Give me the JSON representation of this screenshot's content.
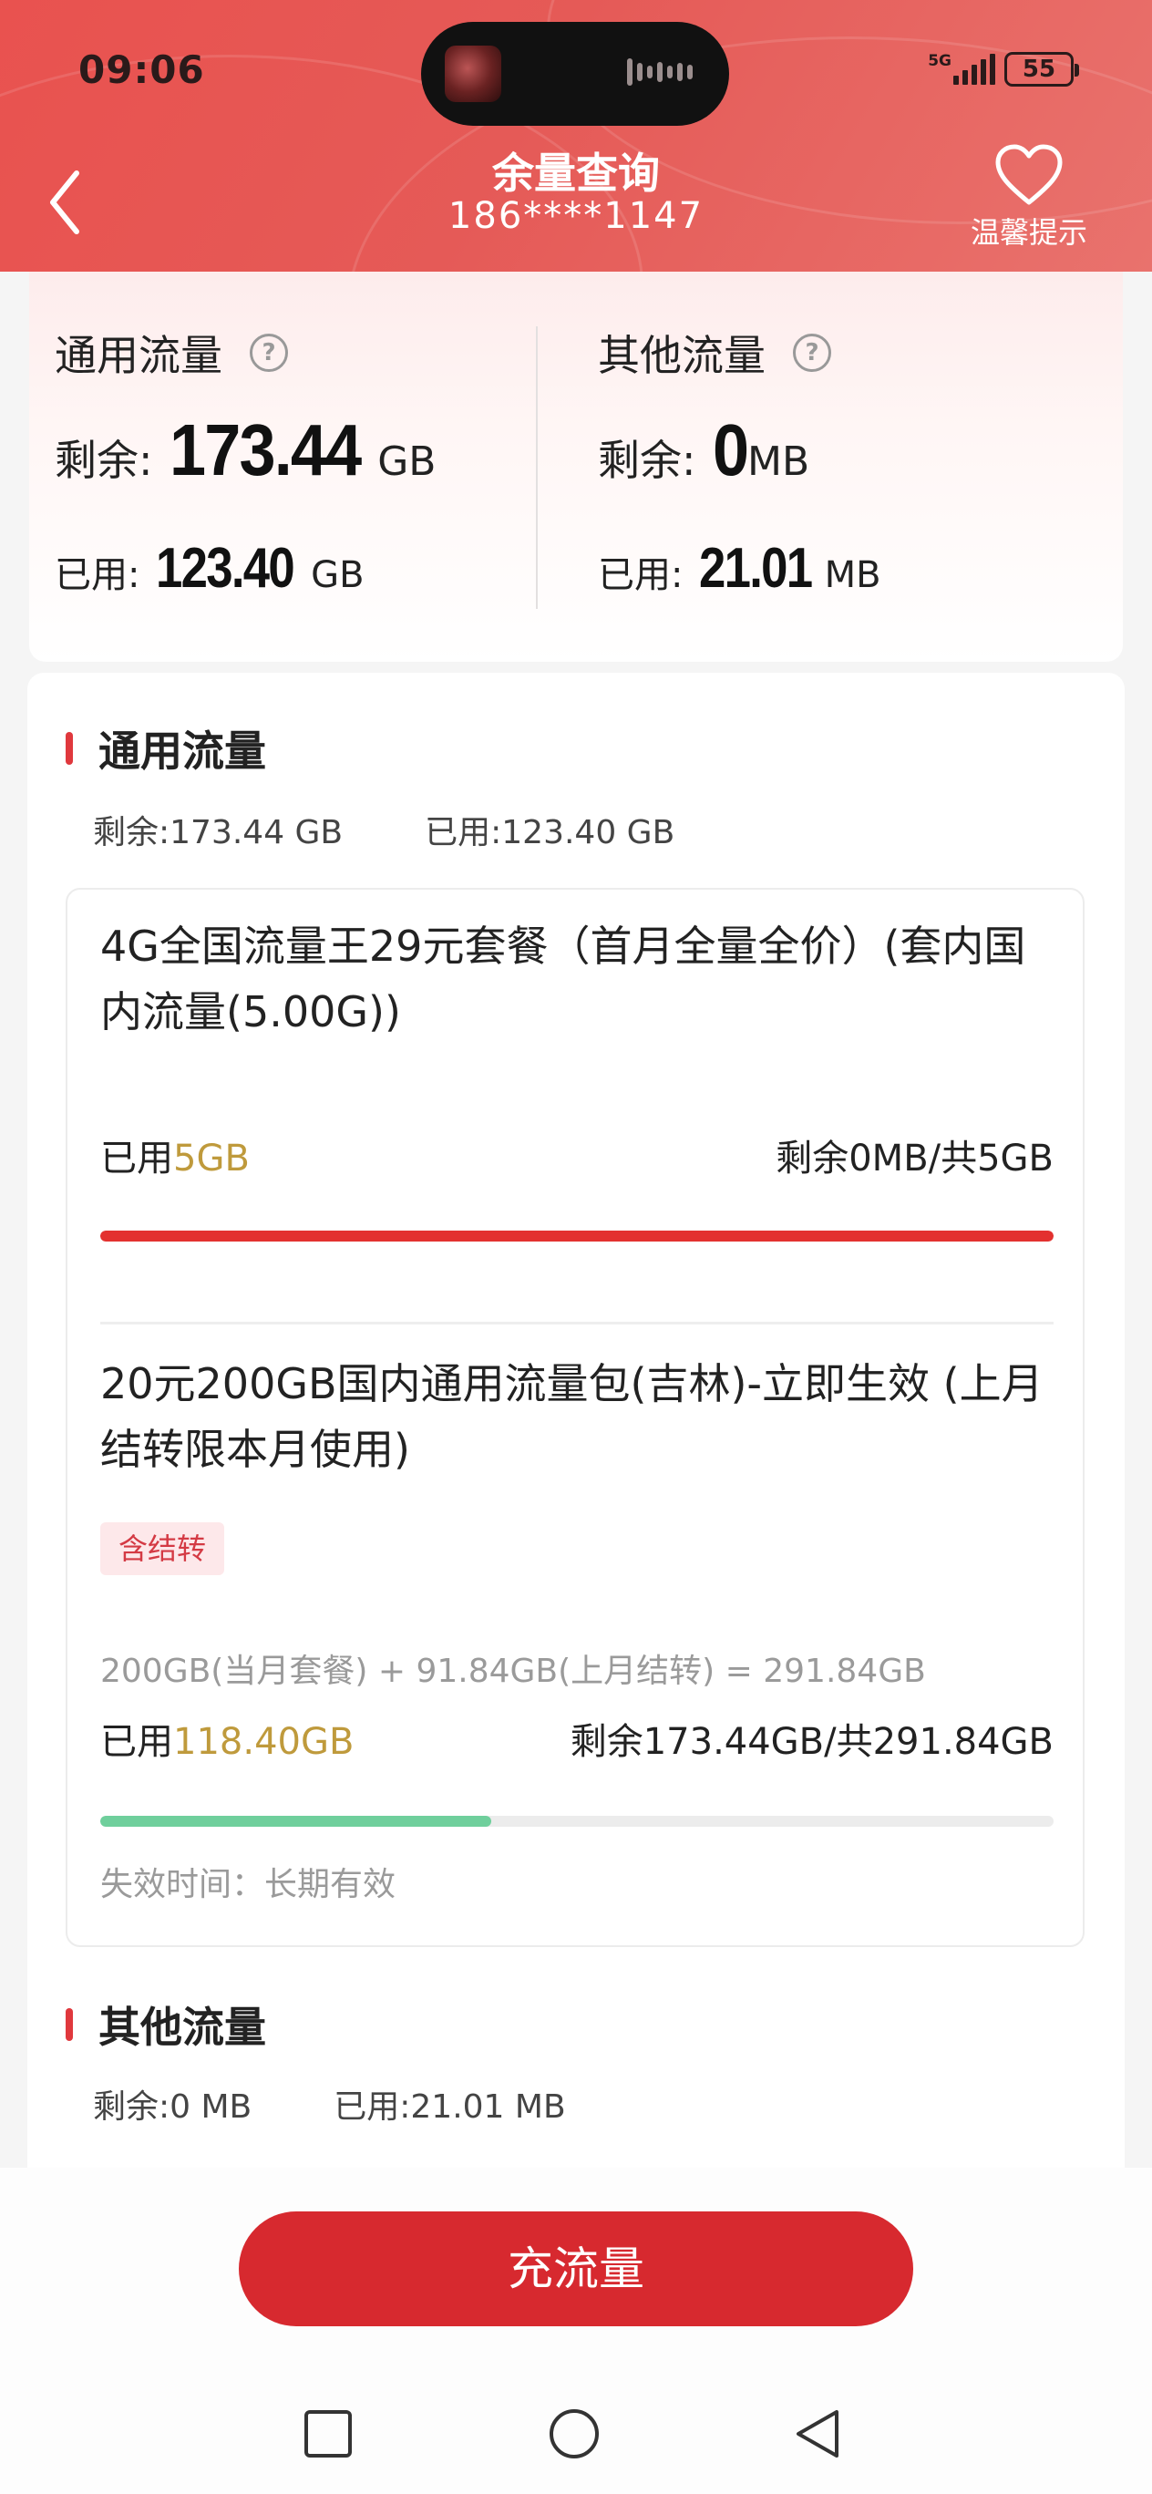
{
  "status_bar": {
    "time": "09:06",
    "network": "5G",
    "battery": "55"
  },
  "header": {
    "title": "余量查询",
    "phone": "186****1147",
    "tip_label": "温馨提示",
    "colors": {
      "brand_red": "#e55a57"
    }
  },
  "summary": {
    "general": {
      "title": "通用流量",
      "remain_label": "剩余:",
      "remain_value": "173.44",
      "remain_unit": "GB",
      "used_label": "已用:",
      "used_value": "123.40",
      "used_unit": "GB"
    },
    "other": {
      "title": "其他流量",
      "remain_label": "剩余:",
      "remain_value": "0",
      "remain_unit": "MB",
      "used_label": "已用:",
      "used_value": "21.01",
      "used_unit": "MB"
    }
  },
  "general_section": {
    "title": "通用流量",
    "remain": "剩余:173.44 GB",
    "used": "已用:123.40 GB",
    "plans": [
      {
        "name": "4G全国流量王29元套餐（首月全量全价）(套内国内流量(5.00G))",
        "used_label": "已用",
        "used_value": "5GB",
        "remain_text": "剩余0MB/共5GB",
        "progress": 1.0,
        "bar_color": "#e3312f"
      },
      {
        "name": "20元200GB国内通用流量包(吉林)-立即生效 (上月结转限本月使用)",
        "tag": "含结转",
        "formula": "200GB(当月套餐) + 91.84GB(上月结转) = 291.84GB",
        "used_label": "已用",
        "used_value": "118.40GB",
        "remain_text": "剩余173.44GB/共291.84GB",
        "progress": 0.41,
        "bar_color": "#6fcf9c",
        "expire": "失效时间：长期有效"
      }
    ]
  },
  "other_section": {
    "title": "其他流量",
    "remain": "剩余:0 MB",
    "used": "已用:21.01 MB"
  },
  "cta": {
    "label": "充流量"
  },
  "nav": {
    "icons": [
      "recents-square-icon",
      "home-circle-icon",
      "back-triangle-icon"
    ]
  }
}
